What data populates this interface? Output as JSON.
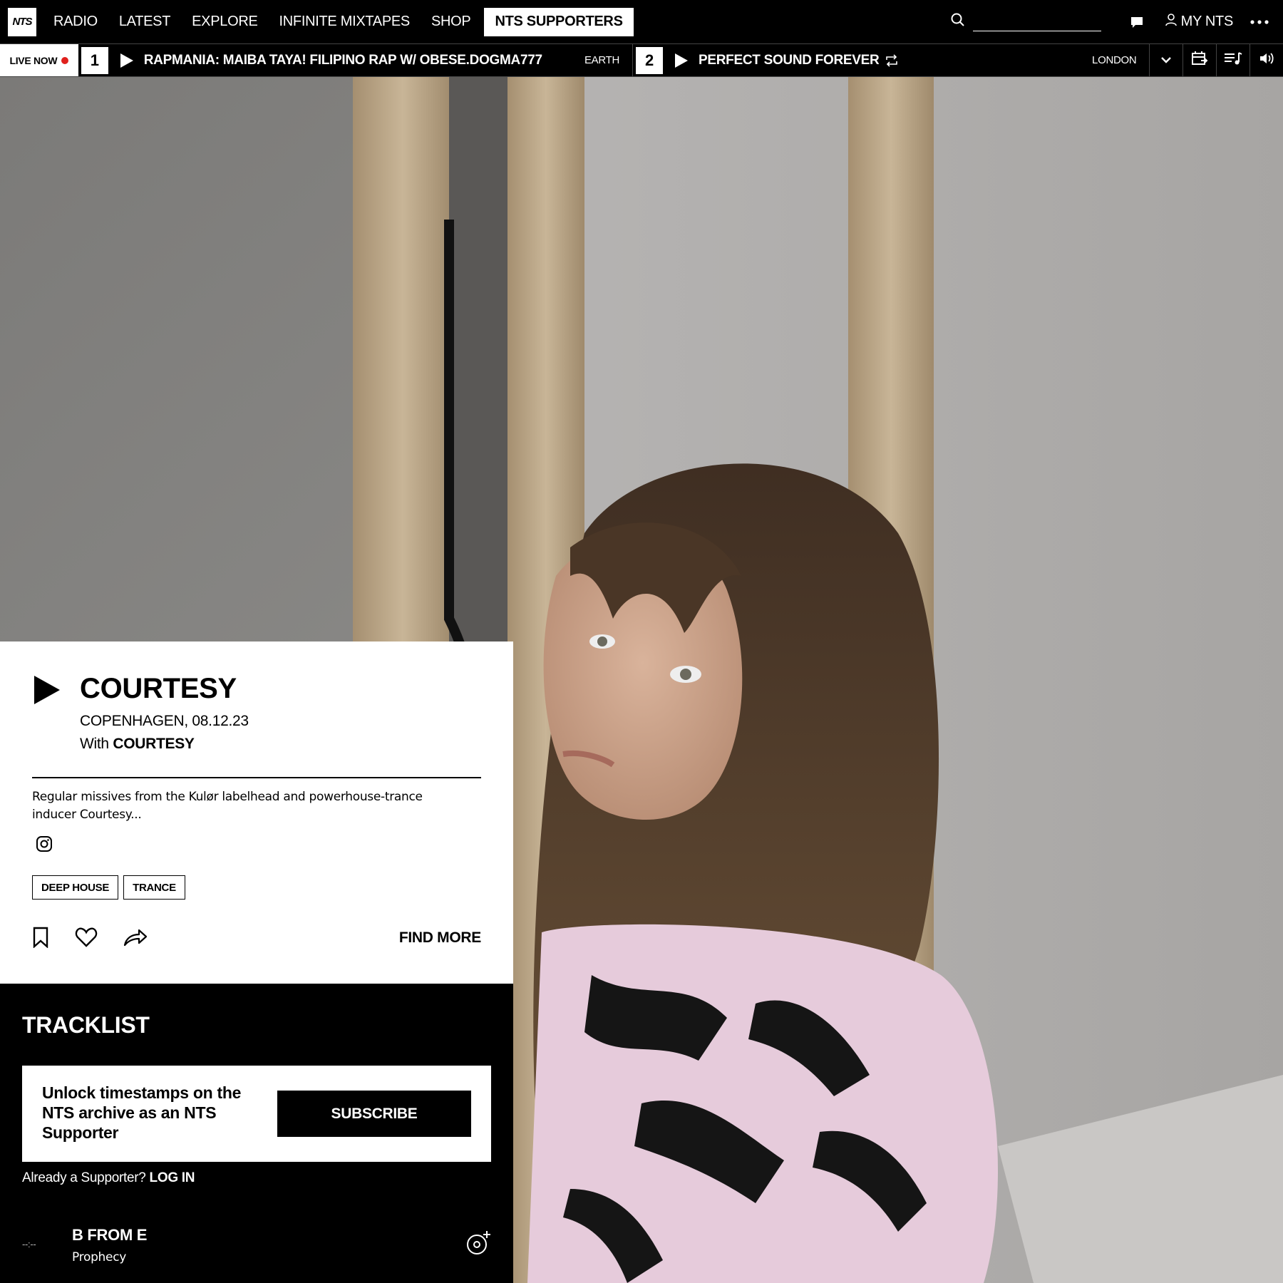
{
  "nav": {
    "logo_text": "NTS",
    "items": [
      "RADIO",
      "LATEST",
      "EXPLORE",
      "INFINITE MIXTAPES",
      "SHOP"
    ],
    "supporters_label": "NTS SUPPORTERS",
    "my_nts_label": "MY NTS",
    "search_placeholder": ""
  },
  "live": {
    "live_now_label": "LIVE NOW",
    "channel1": {
      "number": "1",
      "title": "RAPMANIA: MAIBA TAYA! FILIPINO RAP W/ OBESE.DOGMA777",
      "location": "EARTH"
    },
    "channel2": {
      "number": "2",
      "title": "PERFECT SOUND FOREVER",
      "location": "LONDON"
    }
  },
  "show": {
    "title": "COURTESY",
    "location_date": "COPENHAGEN, 08.12.23",
    "with_prefix": "With",
    "with_name": "COURTESY",
    "description": "Regular missives from the Kulør labelhead and powerhouse-trance inducer Courtesy...",
    "tags": [
      "DEEP HOUSE",
      "TRANCE"
    ],
    "find_more_label": "FIND MORE"
  },
  "tracklist": {
    "heading": "TRACKLIST",
    "unlock_text": "Unlock timestamps on the NTS archive as an NTS Supporter",
    "subscribe_label": "SUBSCRIBE",
    "already_prefix": "Already a Supporter?",
    "login_label": "LOG IN",
    "tracks": [
      {
        "time": "--:--",
        "artist": "B FROM E",
        "title": "Prophecy"
      }
    ]
  },
  "colors": {
    "live_dot": "#e0201c",
    "background": "#000000",
    "card": "#ffffff"
  },
  "icons": [
    "search-icon",
    "chat-icon",
    "user-icon",
    "more-icon",
    "play-icon",
    "repeat-icon",
    "chevron-down-icon",
    "schedule-icon",
    "queue-icon",
    "volume-icon",
    "instagram-icon",
    "bookmark-icon",
    "heart-icon",
    "share-icon",
    "add-track-icon"
  ]
}
